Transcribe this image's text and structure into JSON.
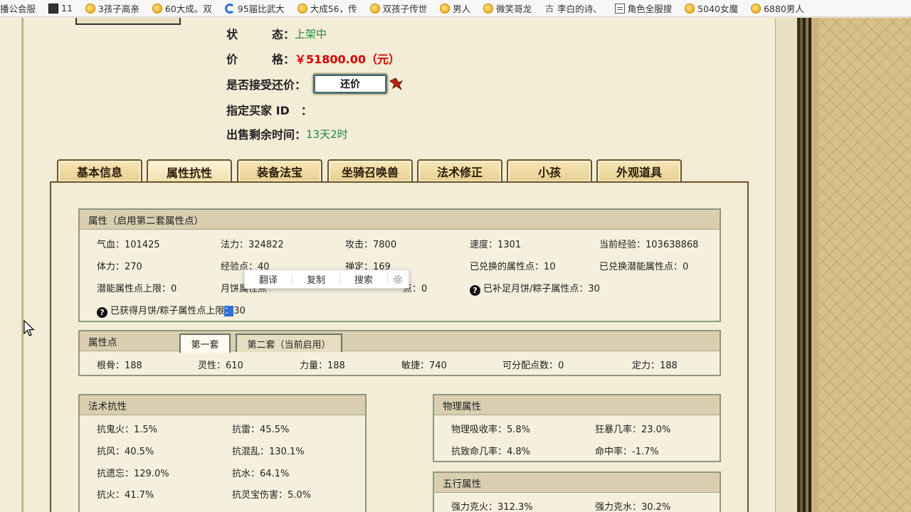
{
  "bookmarks": [
    {
      "label": "播公会服",
      "icon": "none"
    },
    {
      "label": "11",
      "icon": "dark-square-icon"
    },
    {
      "label": "3孩子高亲",
      "icon": "gold-coin-icon"
    },
    {
      "label": "60大成。双",
      "icon": "gold-coin-icon"
    },
    {
      "label": "95届比武大",
      "icon": "blue-c-icon"
    },
    {
      "label": "大成56，传",
      "icon": "gold-coin-icon"
    },
    {
      "label": "双孩子传世",
      "icon": "gold-coin-icon"
    },
    {
      "label": "男人",
      "icon": "gold-coin-icon"
    },
    {
      "label": "微笑哥龙",
      "icon": "gold-coin-icon"
    },
    {
      "label": "李白的诗、",
      "icon": "gu-glyph-icon"
    },
    {
      "label": "角色全服搜",
      "icon": "page-icon"
    },
    {
      "label": "5040女魔",
      "icon": "gold-coin-icon"
    },
    {
      "label": "6880男人",
      "icon": "gold-coin-icon"
    }
  ],
  "gu_glyph": "古",
  "header": {
    "status_label": "状　　　态：",
    "status_value": "上架中",
    "price_label": "价　　　格：",
    "price_value": "￥51800.00（元）",
    "bargain_label": "是否接受还价：",
    "bargain_button": "还价",
    "buyer_label": "指定买家 ID　：",
    "remaining_label": "出售剩余时间：",
    "remaining_value": "13天2时"
  },
  "tabs": [
    {
      "label": "基本信息",
      "active": false
    },
    {
      "label": "属性抗性",
      "active": true
    },
    {
      "label": "装备法宝",
      "active": false
    },
    {
      "label": "坐骑召唤兽",
      "active": false
    },
    {
      "label": "法术修正",
      "active": false
    },
    {
      "label": "小孩",
      "active": false
    },
    {
      "label": "外观道具",
      "active": false
    }
  ],
  "attributes": {
    "title": "属性（启用第二套属性点）",
    "row1": [
      "气血：101425",
      "法力：324822",
      "攻击：7800",
      "速度：1301",
      "当前经验：103638868"
    ],
    "row2": [
      "体力：270",
      "经验点：40",
      "禅定：169",
      "已兑换的属性点：10",
      "已兑换潜能属性点：0"
    ],
    "row3_a": "潜能属性点上限：0",
    "row3_b": "月饼属性点",
    "row3_c": "点：0",
    "row3_d": "已补足月饼/粽子属性点：30",
    "row4_text": "已获得月饼/粽子属性点上限",
    "row4_selected": "：",
    "row4_value": "30"
  },
  "attr_points": {
    "title": "属性点",
    "subtabs": [
      "第一套",
      "第二套（当前启用）"
    ],
    "values": [
      "根骨：188",
      "灵性：610",
      "力量：188",
      "敏捷：740",
      "可分配点数：0",
      "定力：188"
    ]
  },
  "spell_resist": {
    "title": "法术抗性",
    "items": [
      [
        "抗鬼火：1.5%",
        "抗雷：45.5%"
      ],
      [
        "抗风：40.5%",
        "抗混乱：130.1%"
      ],
      [
        "抗遗忘：129.0%",
        "抗水：64.1%"
      ],
      [
        "抗火：41.7%",
        "抗灵宝伤害：5.0%"
      ]
    ]
  },
  "physical": {
    "title": "物理属性",
    "items": [
      [
        "物理吸收率：5.8%",
        "狂暴几率：23.0%"
      ],
      [
        "抗致命几率：4.8%",
        "命中率：-1.7%"
      ]
    ]
  },
  "five_elements": {
    "title": "五行属性",
    "items": [
      [
        "强力克火：312.3%",
        "强力克水：30.2%"
      ]
    ]
  },
  "context_menu": [
    "翻译",
    "复制",
    "搜索"
  ],
  "colors": {
    "green": "#1f8a3a",
    "red": "#d60000",
    "selection": "#2f6fd6"
  }
}
